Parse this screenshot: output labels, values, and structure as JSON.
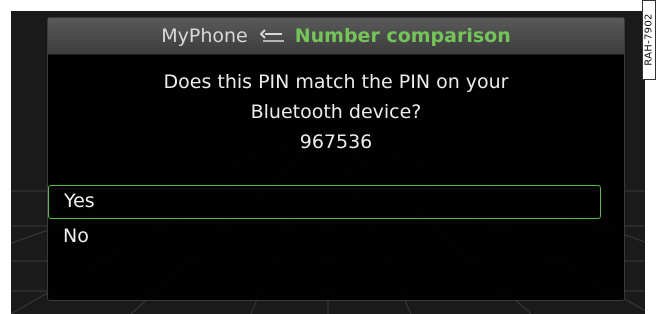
{
  "title_bar": {
    "source": "MyPhone",
    "back_icon": "back-arrow-icon",
    "screen_title": "Number comparison",
    "accent_color": "#74c45a"
  },
  "dialog": {
    "question_line1": "Does this PIN match the PIN on your",
    "question_line2": "Bluetooth device?",
    "pin": "967536"
  },
  "options": [
    {
      "label": "Yes",
      "selected": true
    },
    {
      "label": "No",
      "selected": false
    }
  ],
  "figure_ref": "RAH-7902",
  "colors": {
    "selection_border": "#5bb84a",
    "background": "#000000",
    "text": "#f0f0f0"
  }
}
